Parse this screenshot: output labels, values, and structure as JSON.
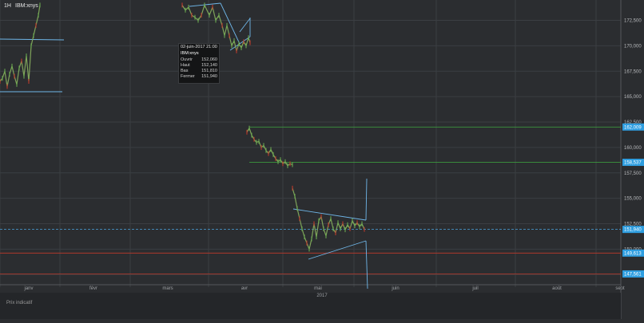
{
  "header": {
    "timeframe": "1H",
    "symbol": "IBM:xnys"
  },
  "tooltip": {
    "date": "02-juin-2017 21:00",
    "symbol": "IBM:xnys",
    "rows": [
      {
        "label": "Ouvrir",
        "value": "152,060"
      },
      {
        "label": "Haut",
        "value": "152,140"
      },
      {
        "label": "Bas",
        "value": "151,810"
      },
      {
        "label": "Fermer",
        "value": "151,940"
      }
    ]
  },
  "footer": {
    "label": "Prix indicatif"
  },
  "chart_data": {
    "type": "line",
    "instrument": "IBM:xnys",
    "interval": "1H",
    "x_ticks": [
      "janv",
      "févr",
      "mars",
      "avr",
      "mai",
      "juin",
      "juil",
      "août",
      "sept"
    ],
    "year_label": "2017",
    "y_ticks": [
      "147,500",
      "150,000",
      "152,500",
      "155,000",
      "157,500",
      "160,000",
      "162,500",
      "165,000",
      "167,500",
      "170,000",
      "172,500"
    ],
    "ylim": [
      146.5,
      174.5
    ],
    "price_tags": [
      {
        "label": "162,009",
        "value": 162.009,
        "color": "#2f9ee0"
      },
      {
        "label": "158,537",
        "value": 158.537,
        "color": "#2f9ee0"
      },
      {
        "label": "151,940",
        "value": 151.94,
        "color": "#2f9ee0"
      },
      {
        "label": "149,613",
        "value": 149.613,
        "color": "#2f9ee0"
      },
      {
        "label": "147,561",
        "value": 147.561,
        "color": "#2f9ee0"
      }
    ],
    "series": [
      {
        "segment": "janvier",
        "points": [
          [
            0,
            166.5
          ],
          [
            3,
            166.8
          ],
          [
            6,
            167.5
          ],
          [
            9,
            166.0
          ],
          [
            12,
            167.2
          ],
          [
            15,
            168.0
          ],
          [
            18,
            167.0
          ],
          [
            21,
            166.2
          ],
          [
            24,
            167.8
          ],
          [
            27,
            168.5
          ],
          [
            30,
            167.0
          ],
          [
            33,
            169.0
          ],
          [
            36,
            166.5
          ],
          [
            39,
            170.0
          ],
          [
            42,
            171.0
          ],
          [
            45,
            172.0
          ],
          [
            48,
            173.0
          ],
          [
            50,
            174.0
          ]
        ]
      },
      {
        "segment": "mars-avril",
        "points": [
          [
            228,
            174.0
          ],
          [
            232,
            173.5
          ],
          [
            236,
            173.8
          ],
          [
            240,
            173.0
          ],
          [
            244,
            172.8
          ],
          [
            248,
            172.5
          ],
          [
            252,
            173.0
          ],
          [
            256,
            174.0
          ],
          [
            262,
            173.0
          ],
          [
            266,
            173.8
          ],
          [
            270,
            172.5
          ],
          [
            274,
            173.0
          ],
          [
            278,
            172.0
          ],
          [
            281,
            171.0
          ],
          [
            284,
            172.0
          ],
          [
            287,
            171.0
          ],
          [
            290,
            170.0
          ],
          [
            293,
            170.5
          ],
          [
            296,
            169.5
          ],
          [
            299,
            170.2
          ],
          [
            302,
            169.8
          ],
          [
            305,
            170.4
          ],
          [
            308,
            170.0
          ],
          [
            311,
            170.8
          ],
          [
            313,
            170.3
          ]
        ]
      },
      {
        "segment": "avril-mai",
        "points": [
          [
            309,
            161.5
          ],
          [
            312,
            161.9
          ],
          [
            315,
            161.2
          ],
          [
            318,
            160.8
          ],
          [
            321,
            160.5
          ],
          [
            324,
            160.6
          ],
          [
            327,
            160.0
          ],
          [
            330,
            160.2
          ],
          [
            333,
            159.7
          ],
          [
            336,
            159.4
          ],
          [
            339,
            159.8
          ],
          [
            342,
            159.3
          ],
          [
            345,
            158.9
          ],
          [
            348,
            158.6
          ],
          [
            351,
            158.8
          ],
          [
            354,
            158.4
          ],
          [
            357,
            158.6
          ],
          [
            360,
            158.2
          ],
          [
            363,
            158.4
          ],
          [
            366,
            158.3
          ]
        ]
      },
      {
        "segment": "mai-juin",
        "points": [
          [
            366,
            156.0
          ],
          [
            369,
            155.2
          ],
          [
            372,
            154.0
          ],
          [
            375,
            153.0
          ],
          [
            378,
            152.0
          ],
          [
            381,
            151.2
          ],
          [
            384,
            150.6
          ],
          [
            387,
            150.0
          ],
          [
            390,
            151.0
          ],
          [
            393,
            152.5
          ],
          [
            396,
            151.2
          ],
          [
            399,
            152.8
          ],
          [
            402,
            153.2
          ],
          [
            405,
            152.0
          ],
          [
            408,
            151.3
          ],
          [
            411,
            152.4
          ],
          [
            414,
            153.0
          ],
          [
            417,
            152.0
          ],
          [
            420,
            151.6
          ],
          [
            423,
            152.6
          ],
          [
            426,
            152.0
          ],
          [
            429,
            152.5
          ],
          [
            432,
            151.9
          ],
          [
            435,
            152.4
          ],
          [
            438,
            152.0
          ],
          [
            441,
            152.8
          ],
          [
            444,
            152.3
          ],
          [
            447,
            152.6
          ],
          [
            450,
            152.2
          ],
          [
            453,
            152.5
          ],
          [
            456,
            151.94
          ]
        ]
      }
    ],
    "horizontal_levels": [
      {
        "value": 162.009,
        "color": "#3fa83f"
      },
      {
        "value": 158.537,
        "color": "#3fa83f"
      },
      {
        "value": 149.613,
        "color": "#c0392b"
      },
      {
        "value": 147.561,
        "color": "#c0392b"
      },
      {
        "value": 151.94,
        "color": "#4aa3df",
        "style": "dashed"
      }
    ],
    "grid": true
  }
}
